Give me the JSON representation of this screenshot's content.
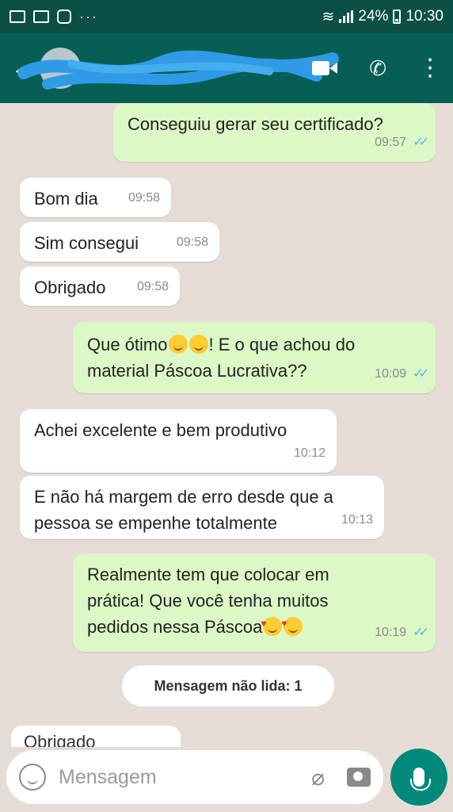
{
  "status_bar": {
    "battery": "24%",
    "time": "10:30"
  },
  "header": {
    "contact_name": "",
    "icons": [
      "back-arrow-icon",
      "video-call-icon",
      "voice-call-icon",
      "more-options-icon"
    ]
  },
  "messages": [
    {
      "direction": "outgoing",
      "text": "Conseguiu gerar seu certificado?",
      "time": "09:57",
      "status": "read"
    },
    {
      "direction": "incoming",
      "text": "Bom dia",
      "time": "09:58"
    },
    {
      "direction": "incoming",
      "text": "Sim consegui",
      "time": "09:58"
    },
    {
      "direction": "incoming",
      "text": "Obrigado",
      "time": "09:58"
    },
    {
      "direction": "outgoing",
      "line1_a": "Que ótimo",
      "line1_b": "!  E o que achou do",
      "line2": "material Páscoa Lucrativa??",
      "time": "10:09",
      "status": "read"
    },
    {
      "direction": "incoming",
      "text": "Achei excelente e bem produtivo",
      "time": "10:12"
    },
    {
      "direction": "incoming",
      "line1": "E não há margem de erro desde que a",
      "line2": "pessoa se empenhe totalmente",
      "time": "10:13"
    },
    {
      "direction": "outgoing",
      "line1": "Realmente tem que colocar em",
      "line2": "prática!  Que você tenha muitos",
      "line3": "pedidos nessa Páscoa",
      "time": "10:19",
      "status": "read"
    }
  ],
  "unread_banner": "Mensagem não lida: 1",
  "partial_message": "Obrigado",
  "input": {
    "placeholder": "Mensagem"
  },
  "colors": {
    "header": "#075e54",
    "status_bar": "#0b4f47",
    "chat_background": "#e5ddd5",
    "outgoing_bubble": "#dcf8c6",
    "incoming_bubble": "#ffffff",
    "read_ticks": "#4fb6ec",
    "mic_button": "#00897b"
  }
}
